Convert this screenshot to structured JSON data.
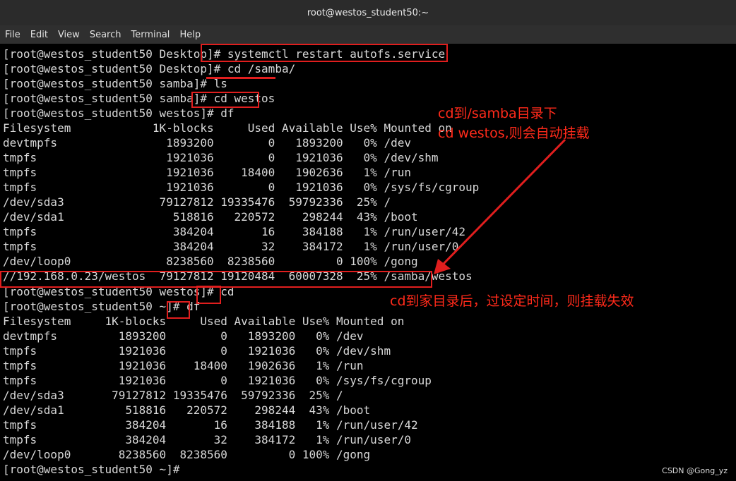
{
  "window": {
    "title": "root@westos_student50:~"
  },
  "menu": [
    "File",
    "Edit",
    "View",
    "Search",
    "Terminal",
    "Help"
  ],
  "terminal": {
    "lines": [
      "[root@westos_student50 Desktop]# systemctl restart autofs.service",
      "[root@westos_student50 Desktop]# cd /samba/",
      "[root@westos_student50 samba]# ls",
      "[root@westos_student50 samba]# cd westos",
      "[root@westos_student50 westos]# df",
      "Filesystem            1K-blocks     Used Available Use% Mounted on",
      "devtmpfs                1893200        0   1893200   0% /dev",
      "tmpfs                   1921036        0   1921036   0% /dev/shm",
      "tmpfs                   1921036    18400   1902636   1% /run",
      "tmpfs                   1921036        0   1921036   0% /sys/fs/cgroup",
      "/dev/sda3              79127812 19335476  59792336  25% /",
      "/dev/sda1                518816   220572    298244  43% /boot",
      "tmpfs                    384204       16    384188   1% /run/user/42",
      "tmpfs                    384204       32    384172   1% /run/user/0",
      "/dev/loop0              8238560  8238560         0 100% /gong",
      "//192.168.0.23/westos  79127812 19120484  60007328  25% /samba/westos",
      "[root@westos_student50 westos]# cd",
      "[root@westos_student50 ~]# df",
      "Filesystem     1K-blocks     Used Available Use% Mounted on",
      "devtmpfs         1893200        0   1893200   0% /dev",
      "tmpfs            1921036        0   1921036   0% /dev/shm",
      "tmpfs            1921036    18400   1902636   1% /run",
      "tmpfs            1921036        0   1921036   0% /sys/fs/cgroup",
      "/dev/sda3       79127812 19335476  59792336  25% /",
      "/dev/sda1         518816   220572    298244  43% /boot",
      "tmpfs             384204       16    384188   1% /run/user/42",
      "tmpfs             384204       32    384172   1% /run/user/0",
      "/dev/loop0       8238560  8238560         0 100% /gong",
      "[root@westos_student50 ~]#"
    ]
  },
  "annotations": {
    "note1_line1": "cd到/samba目录下",
    "note1_line2": "cd westos,则会自动挂载",
    "note2": "cd到家目录后，过设定时间，则挂载失效",
    "color": "#e01e1e"
  },
  "watermark": "CSDN @Gong_yz"
}
